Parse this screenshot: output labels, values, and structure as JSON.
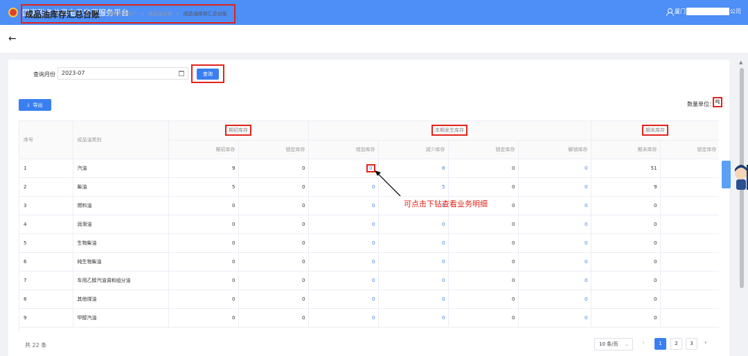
{
  "header": {
    "app_title": "国家税务总局电子发票服务平台",
    "user_prefix": "厦门",
    "user_suffix": "公司"
  },
  "titlebar": {
    "back_arrow": "←",
    "page_title": "成品油库存汇总台账",
    "breadcrumb": [
      "税务数字账户",
      "成品油业务",
      "成品油库存汇总台账"
    ],
    "separator": ">"
  },
  "query": {
    "month_label": "查询月份",
    "month_value": "2023-07",
    "query_button": "查询"
  },
  "toolbar": {
    "export_label": "导出",
    "unit_label": "数量单位：",
    "unit_value": "吨"
  },
  "table": {
    "col_seq": "序号",
    "col_category": "成品油类别",
    "groups": [
      "期初库存",
      "本期发生库存",
      "期末库存"
    ],
    "subheaders": [
      "期初库存",
      "锁定库存",
      "增加库存",
      "减少库存",
      "锁定库存",
      "解锁库存",
      "期末库存",
      "锁定库存"
    ],
    "rows": [
      {
        "seq": "1",
        "category": "汽油",
        "v1": "9",
        "v2": "0",
        "v3": "0",
        "v4": "8",
        "v5": "0",
        "v6": "0",
        "v7": "51"
      },
      {
        "seq": "2",
        "category": "柴油",
        "v1": "5",
        "v2": "0",
        "v3": "0",
        "v4": "5",
        "v5": "0",
        "v6": "0",
        "v7": "9"
      },
      {
        "seq": "3",
        "category": "燃料油",
        "v1": "0",
        "v2": "0",
        "v3": "0",
        "v4": "0",
        "v5": "0",
        "v6": "0",
        "v7": "0"
      },
      {
        "seq": "4",
        "category": "润滑油",
        "v1": "0",
        "v2": "0",
        "v3": "0",
        "v4": "0",
        "v5": "0",
        "v6": "0",
        "v7": "0"
      },
      {
        "seq": "5",
        "category": "生物柴油",
        "v1": "0",
        "v2": "0",
        "v3": "0",
        "v4": "0",
        "v5": "0",
        "v6": "0",
        "v7": "0"
      },
      {
        "seq": "6",
        "category": "纯生物柴油",
        "v1": "0",
        "v2": "0",
        "v3": "0",
        "v4": "0",
        "v5": "0",
        "v6": "0",
        "v7": "0"
      },
      {
        "seq": "7",
        "category": "车用乙醇汽油调和组分油",
        "v1": "0",
        "v2": "0",
        "v3": "0",
        "v4": "0",
        "v5": "0",
        "v6": "0",
        "v7": "0"
      },
      {
        "seq": "8",
        "category": "其他煤油",
        "v1": "0",
        "v2": "0",
        "v3": "0",
        "v4": "0",
        "v5": "0",
        "v6": "0",
        "v7": "0"
      },
      {
        "seq": "9",
        "category": "甲醇汽油",
        "v1": "0",
        "v2": "0",
        "v3": "0",
        "v4": "0",
        "v5": "0",
        "v6": "0",
        "v7": "0"
      }
    ]
  },
  "annotation": {
    "drill_hint": "可点击下钻查看业务明细"
  },
  "pagination": {
    "total_text": "共 22 条",
    "page_size": "10 条/页",
    "pages": [
      "1",
      "2",
      "3"
    ],
    "active_page": "1",
    "prev": "‹",
    "next": "›"
  },
  "colors": {
    "header_blue": "#4d8ef7",
    "primary": "#3a7ff0",
    "annotation_red": "#e2231a"
  }
}
